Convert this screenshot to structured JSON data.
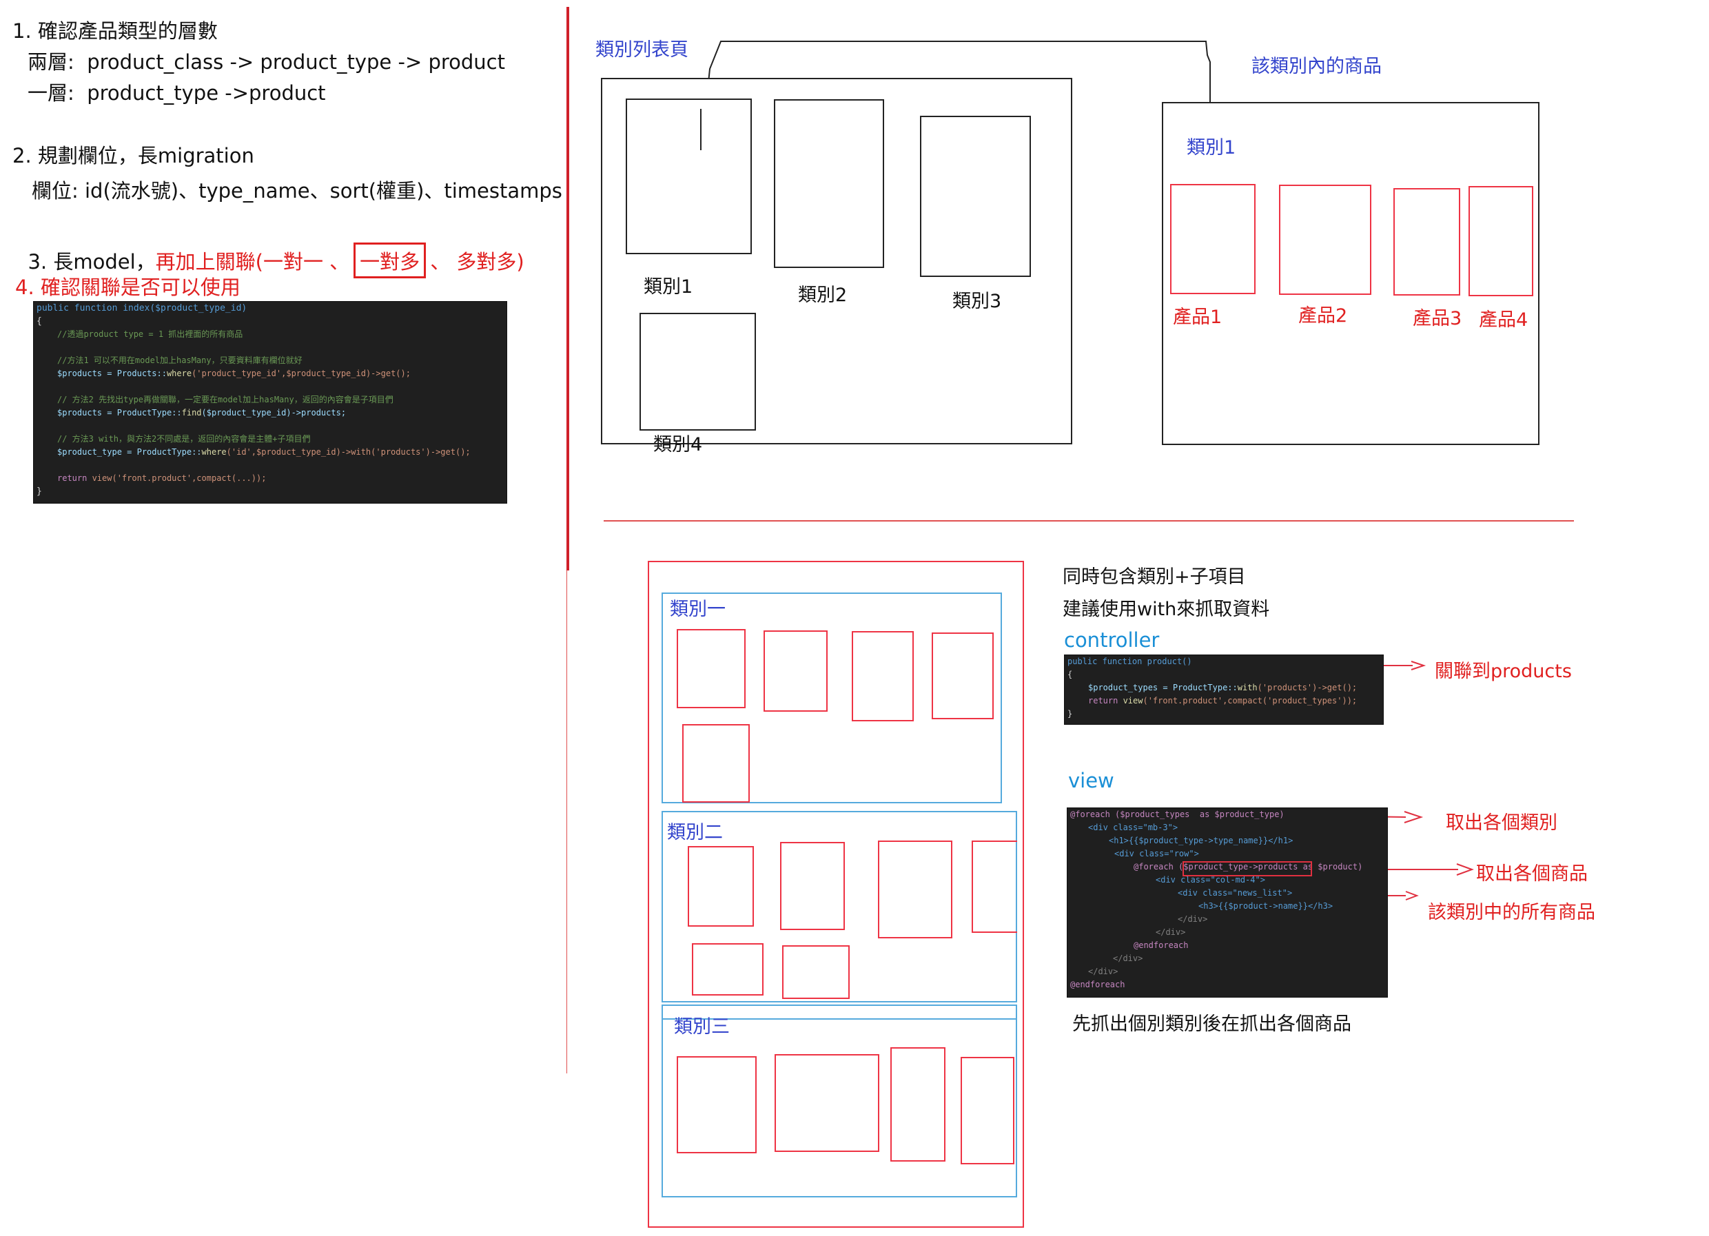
{
  "steps": {
    "s1_title": "1. 確認產品類型的層數",
    "s1_two": "兩層:  product_class -> product_type -> product",
    "s1_one": "一層:  product_type ->product",
    "s2_title": "2. 規劃欄位，長migration",
    "s2_fields": "欄位: id(流水號)、type_name、sort(權重)、timestamps",
    "s3_prefix": "3. 長model，",
    "s3_red_a": "再加上關聯(一對一 、",
    "s3_boxed": "一對多",
    "s3_red_b": "、 多對多)",
    "s4_title": "4. 確認關聯是否可以使用"
  },
  "code1": {
    "l1": "public function index($product_type_id)",
    "l2": "{",
    "l3": "//透過product type = 1 抓出裡面的所有商品",
    "l4": "//方法1 可以不用在model加上hasMany，只要資料庫有欄位就好",
    "l5a": "$products = Products::",
    "l5b": "where",
    "l5c": "('product_type_id',$product_type_id)->get();",
    "l6": "// 方法2 先找出type再做關聯，一定要在model加上hasMany，返回的內容會是子項目們",
    "l7a": "$products = ProductType::",
    "l7b": "find",
    "l7c": "($product_type_id)->products;",
    "l8": "// 方法3 with，與方法2不同處是，返回的內容會是主體+子項目們",
    "l9a": "$product_type = ProductType::",
    "l9b": "where",
    "l9c": "('id',$product_type_id)->with('products')->get();",
    "l10a": "return ",
    "l10b": "view('front.product',compact(...));",
    "l11": "}"
  },
  "top": {
    "list_title": "類別列表頁",
    "cat1": "類別1",
    "cat2": "類別2",
    "cat3": "類別3",
    "cat4": "類別4",
    "detail_title": "該類別內的商品",
    "detail_cat": "類別1",
    "prod1": "產品1",
    "prod2": "產品2",
    "prod3": "產品3",
    "prod4": "產品4"
  },
  "bottom": {
    "group1": "類別一",
    "group2": "類別二",
    "group3": "類別三",
    "note1": "同時包含類別+子項目",
    "note2": "建議使用with來抓取資料",
    "controller_label": "controller",
    "view_label": "view",
    "footer_note": "先抓出個別類別後在抓出各個商品",
    "arrow1": "關聯到products",
    "arrow2": "取出各個類別",
    "arrow3": "取出各個商品",
    "arrow4": "該類別中的所有商品"
  },
  "code2": {
    "l1": "public function product()",
    "l2": "{",
    "l3a": "$product_types = ProductType::",
    "l3b": "with",
    "l3c": "('products')->get();",
    "l4a": "return ",
    "l4b": "view",
    "l4c": "('front.product',compact('product_types'));",
    "l5": "}"
  },
  "code3": {
    "l1": "@foreach ($product_types  as $product_type)",
    "l2": "<div class=\"mb-3\">",
    "l3": "<h1>{{$product_type->type_name}}</h1>",
    "l4": "<div class=\"row\">",
    "l5": "@foreach ($product_type->products as $product)",
    "l6": "<div class=\"col-md-4\">",
    "l7": "<div class=\"news_list\">",
    "l8": "<h3>{{$product->name}}</h3>",
    "l9": "</div>",
    "l10": "</div>",
    "l11": "@endforeach",
    "l12": "</div>",
    "l13": "</div>",
    "l14": "@endforeach"
  }
}
